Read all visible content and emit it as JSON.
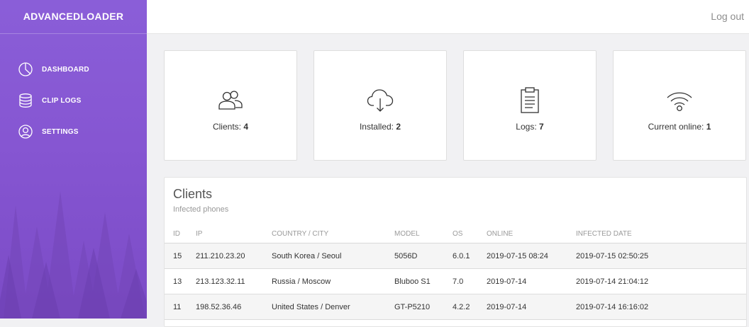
{
  "sidebar": {
    "brand": "ADVANCEDLOADER",
    "items": [
      {
        "label": "DASHBOARD",
        "icon": "pie-chart-icon"
      },
      {
        "label": "CLIP LOGS",
        "icon": "database-icon"
      },
      {
        "label": "SETTINGS",
        "icon": "user-circle-icon"
      }
    ]
  },
  "header": {
    "logout": "Log out"
  },
  "stats": [
    {
      "label": "Clients:",
      "value": "4",
      "icon": "users-icon"
    },
    {
      "label": "Installed:",
      "value": "2",
      "icon": "cloud-download-icon"
    },
    {
      "label": "Logs:",
      "value": "7",
      "icon": "clipboard-icon"
    },
    {
      "label": "Current online:",
      "value": "1",
      "icon": "wifi-icon"
    }
  ],
  "clients": {
    "title": "Clients",
    "subtitle": "Infected phones",
    "columns": [
      "ID",
      "IP",
      "COUNTRY / CITY",
      "MODEL",
      "OS",
      "ONLINE",
      "INFECTED DATE"
    ],
    "rows": [
      [
        "15",
        "211.210.23.20",
        "South Korea / Seoul",
        "5056D",
        "6.0.1",
        "2019-07-15 08:24",
        "2019-07-15 02:50:25"
      ],
      [
        "13",
        "213.123.32.11",
        "Russia / Moscow",
        "Bluboo S1",
        "7.0",
        "2019-07-14",
        "2019-07-14 21:04:12"
      ],
      [
        "11",
        "198.52.36.46",
        "United States / Denver",
        "GT-P5210",
        "4.2.2",
        "2019-07-14",
        "2019-07-14 16:16:02"
      ]
    ]
  },
  "colors": {
    "sidebar": "#8656d2",
    "accent": "#ffffff"
  }
}
